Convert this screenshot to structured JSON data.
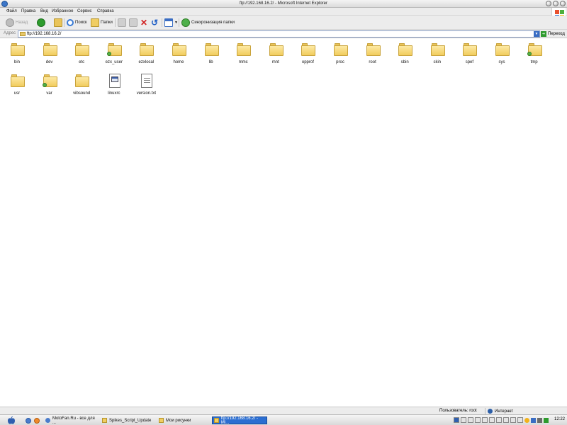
{
  "window": {
    "title": "ftp://192.168.16.2/ - Microsoft Internet Explorer"
  },
  "menu": [
    "Файл",
    "Правка",
    "Вид",
    "Избранное",
    "Сервис",
    "Справка"
  ],
  "toolbar": {
    "back": "Назад",
    "search": "Поиск",
    "folders": "Папки",
    "sync": "Синхронизация папки"
  },
  "address": {
    "label": "Адрес",
    "value": "ftp://192.168.16.2/",
    "go": "Переход"
  },
  "items": [
    {
      "name": "bin",
      "kind": "folder",
      "link": false
    },
    {
      "name": "dev",
      "kind": "folder",
      "link": false
    },
    {
      "name": "etc",
      "kind": "folder",
      "link": false
    },
    {
      "name": "ezx_user",
      "kind": "folder",
      "link": true
    },
    {
      "name": "ezxlocal",
      "kind": "folder",
      "link": false
    },
    {
      "name": "home",
      "kind": "folder",
      "link": false
    },
    {
      "name": "lib",
      "kind": "folder",
      "link": false
    },
    {
      "name": "mmc",
      "kind": "folder",
      "link": false
    },
    {
      "name": "mnt",
      "kind": "folder",
      "link": false
    },
    {
      "name": "opprof",
      "kind": "folder",
      "link": false
    },
    {
      "name": "proc",
      "kind": "folder",
      "link": false
    },
    {
      "name": "root",
      "kind": "folder",
      "link": false
    },
    {
      "name": "sbin",
      "kind": "folder",
      "link": false
    },
    {
      "name": "skin",
      "kind": "folder",
      "link": false
    },
    {
      "name": "spef",
      "kind": "folder",
      "link": false
    },
    {
      "name": "sys",
      "kind": "folder",
      "link": false
    },
    {
      "name": "tmp",
      "kind": "folder",
      "link": true
    },
    {
      "name": "usr",
      "kind": "folder",
      "link": false
    },
    {
      "name": "var",
      "kind": "folder",
      "link": true
    },
    {
      "name": "vibsound",
      "kind": "folder",
      "link": false
    },
    {
      "name": "linuxrc",
      "kind": "app",
      "link": false
    },
    {
      "name": "version.txt",
      "kind": "txt",
      "link": false
    }
  ],
  "status": {
    "user": "Пользователь: root",
    "zone": "Интернет"
  },
  "taskbar": {
    "tasks": [
      {
        "label": "MotoFan.Ru - все для ...",
        "active": false
      },
      {
        "label": "Spikes_Script_Update",
        "active": false
      },
      {
        "label": "Мои рисунки",
        "active": false
      },
      {
        "label": "ftp://192.168.16.2/ - Mi...",
        "active": true
      }
    ],
    "clock": "12:22"
  }
}
